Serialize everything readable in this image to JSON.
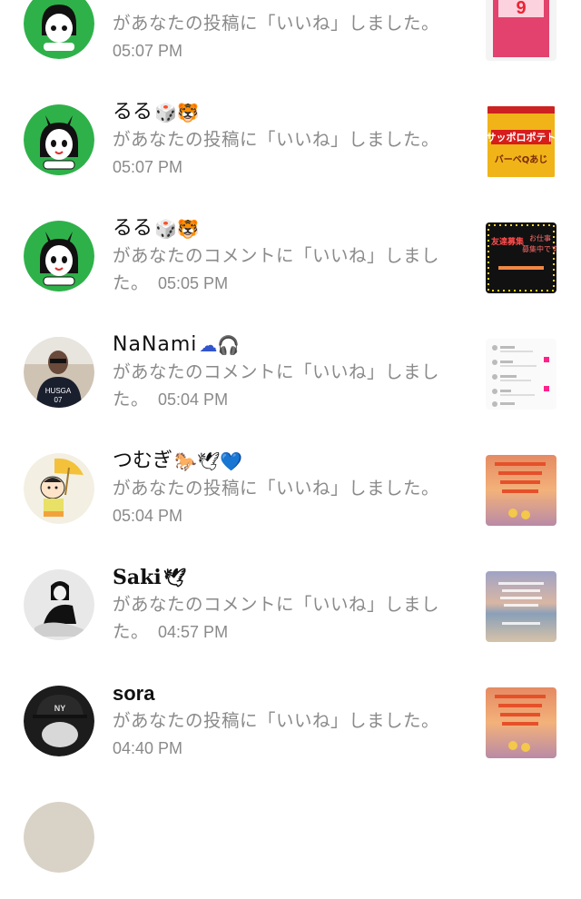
{
  "notifications": [
    {
      "name": "",
      "emojis": "",
      "message": "があなたの投稿に「いいね」しました。",
      "time": "05:07 PM",
      "avatar": "green-girl-avatar",
      "thumb": "pink-snack-thumbnail"
    },
    {
      "name": "るる",
      "emojis": "🎲🐯",
      "message": "があなたの投稿に「いいね」しました。",
      "time": "05:07 PM",
      "avatar": "green-girl-avatar",
      "thumb": "sapporo-potato-thumbnail",
      "thumb_text": [
        "サッポロポテト",
        "バーベQあじ"
      ]
    },
    {
      "name": "るる",
      "emojis": "🎲🐯",
      "message_line1": "があなたのコメントに「いいね」しまし",
      "message_line2": "た。",
      "time": "05:05 PM",
      "avatar": "green-girl-avatar",
      "thumb": "friend-recruit-thumbnail",
      "thumb_text": [
        "友達募集",
        "お仕事",
        "募集中です"
      ]
    },
    {
      "name": "NaNami",
      "emojis": "☁🎧",
      "message_line1": "があなたのコメントに「いいね」しまし",
      "message_line2": "た。",
      "time": "05:04 PM",
      "avatar": "photo-avatar",
      "thumb": "screenshot-list-thumbnail"
    },
    {
      "name": "つむぎ",
      "emojis": "🐎🕊💙",
      "message": "があなたの投稿に「いいね」しました。",
      "time": "05:04 PM",
      "avatar": "cartoon-avatar",
      "thumb": "sunset-text-thumbnail"
    },
    {
      "name": "Saki",
      "emojis": "🕊",
      "message_line1": "があなたのコメントに「いいね」しまし",
      "message_line2": "た。",
      "time": "04:57 PM",
      "avatar": "bw-photo-avatar",
      "thumb": "beach-text-thumbnail"
    },
    {
      "name": "sora",
      "emojis": "",
      "message": "があなたの投稿に「いいね」しました。",
      "time": "04:40 PM",
      "avatar": "cap-photo-avatar",
      "thumb": "sunset-text-thumbnail"
    }
  ]
}
